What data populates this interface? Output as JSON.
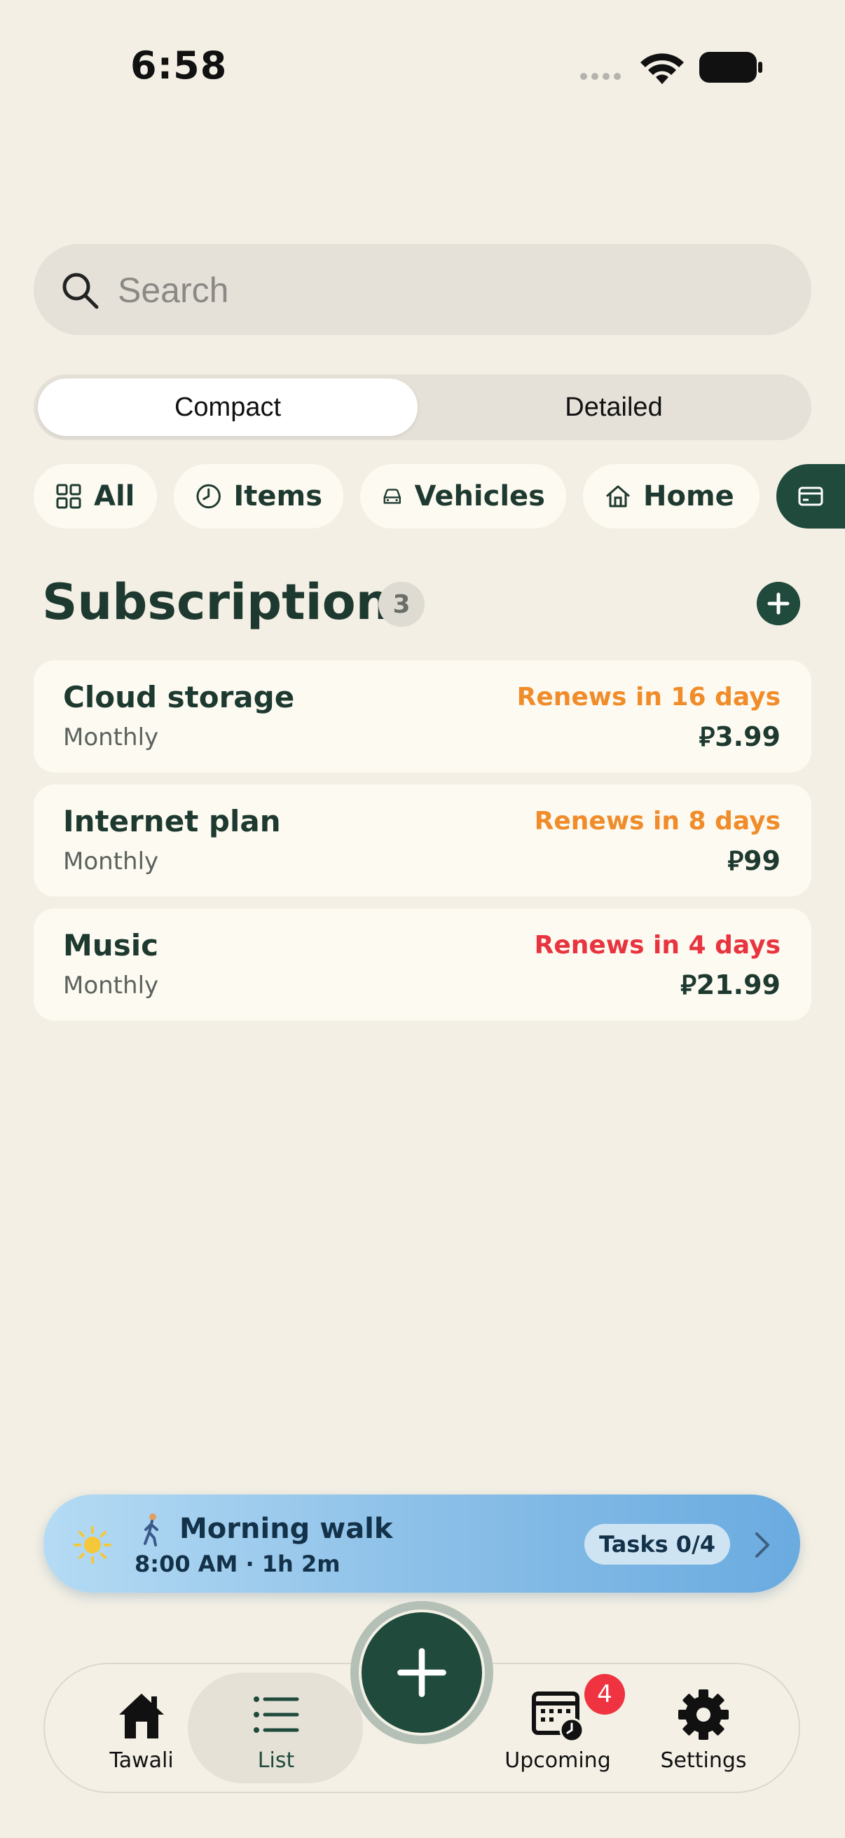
{
  "status_bar": {
    "time": "6:58"
  },
  "search": {
    "placeholder": "Search"
  },
  "view_toggle": {
    "options": [
      "Compact",
      "Detailed"
    ],
    "selected": "Compact"
  },
  "filter_chips": [
    {
      "label": "All",
      "icon": "grid-icon"
    },
    {
      "label": "Items",
      "icon": "clock-icon"
    },
    {
      "label": "Vehicles",
      "icon": "car-icon"
    },
    {
      "label": "Home",
      "icon": "house-icon"
    },
    {
      "label": "",
      "icon": "card-icon",
      "selected": true
    }
  ],
  "section": {
    "title": "Subscriptions",
    "count": "3"
  },
  "subscriptions": [
    {
      "name": "Cloud storage",
      "cycle": "Monthly",
      "renewal": "Renews in 16 days",
      "price": "⃁3.99",
      "status_color": "#f08c2a"
    },
    {
      "name": "Internet plan",
      "cycle": "Monthly",
      "renewal": "Renews in 8 days",
      "price": "⃁99",
      "status_color": "#f08c2a"
    },
    {
      "name": "Music",
      "cycle": "Monthly",
      "renewal": "Renews in 4 days",
      "price": "⃁21.99",
      "status_color": "#e8343f"
    }
  ],
  "activity_banner": {
    "title": "Morning walk",
    "subtitle": "8:00 AM · 1h 2m",
    "tasks": "Tasks 0/4"
  },
  "tab_bar": {
    "items": [
      {
        "label": "Tawali",
        "icon": "house-icon"
      },
      {
        "label": "List",
        "icon": "list-icon",
        "active": true
      },
      {
        "label": "Upcoming",
        "icon": "calendar-clock-icon",
        "badge": "4"
      },
      {
        "label": "Settings",
        "icon": "gear-icon"
      }
    ]
  },
  "colors": {
    "background": "#f3efe4",
    "primary": "#1f4a3c",
    "warning": "#f08c2a",
    "danger": "#e8343f"
  }
}
